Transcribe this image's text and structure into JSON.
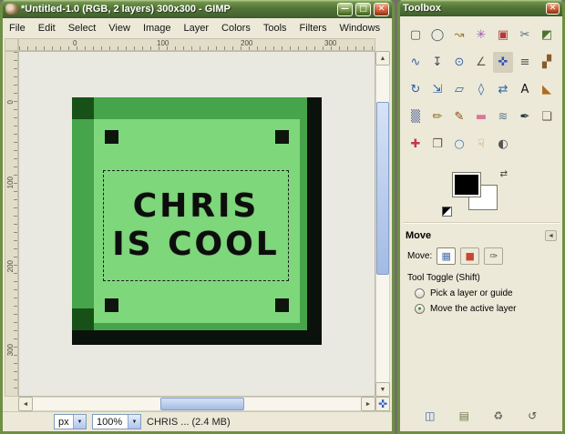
{
  "main_window": {
    "title": "*Untitled-1.0 (RGB, 2 layers) 300x300 - GIMP",
    "controls": {
      "minimize": "—",
      "maximize": "□",
      "close": "✕"
    },
    "menus": [
      "File",
      "Edit",
      "Select",
      "View",
      "Image",
      "Layer",
      "Colors",
      "Tools",
      "Filters",
      "Windows",
      "Help"
    ],
    "h_ruler_marks": [
      "0",
      "100",
      "200",
      "300"
    ],
    "v_ruler_marks": [
      "0",
      "100",
      "200",
      "300"
    ],
    "canvas": {
      "line1": "CHRIS",
      "line2": "IS COOL"
    },
    "statusbar": {
      "unit": "px",
      "zoom": "100%",
      "message": "CHRIS ... (2.4 MB)",
      "dropdown_arrow": "▼"
    },
    "scroll_arrows": {
      "left": "◄",
      "right": "►",
      "up": "▲",
      "down": "▼"
    },
    "navigation_glyph": "✜"
  },
  "image_colors": {
    "outer_green": "#46a44a",
    "inner_green": "#7fd77c",
    "corner_dark_green": "#175117",
    "shadow_black": "#0b120b"
  },
  "toolbox": {
    "title": "Toolbox",
    "close_glyph": "✕",
    "tools": [
      {
        "name": "rect-select-tool",
        "glyph": "▢",
        "color": "#4a5a6a"
      },
      {
        "name": "ellipse-select-tool",
        "glyph": "◯",
        "color": "#4a5a6a"
      },
      {
        "name": "free-select-tool",
        "glyph": "↝",
        "color": "#a07828"
      },
      {
        "name": "fuzzy-select-tool",
        "glyph": "✳",
        "color": "#9a5ab0"
      },
      {
        "name": "select-by-color-tool",
        "glyph": "▣",
        "color": "#b03a3a"
      },
      {
        "name": "scissors-select-tool",
        "glyph": "✂",
        "color": "#5a6a7a"
      },
      {
        "name": "foreground-select-tool",
        "glyph": "◩",
        "color": "#50702e"
      },
      {
        "name": "paths-tool",
        "glyph": "∿",
        "color": "#3a62a8"
      },
      {
        "name": "color-picker-tool",
        "glyph": "↧",
        "color": "#3a4a5a"
      },
      {
        "name": "zoom-tool",
        "glyph": "⊙",
        "color": "#3a62a8"
      },
      {
        "name": "measure-tool",
        "glyph": "∠",
        "color": "#6a5a3a"
      },
      {
        "name": "move-tool",
        "glyph": "✜",
        "color": "#2a52be",
        "bg": "#d4cfba"
      },
      {
        "name": "align-tool",
        "glyph": "≡",
        "color": "#555555"
      },
      {
        "name": "crop-tool",
        "glyph": "▞",
        "color": "#8a5a2a"
      },
      {
        "name": "rotate-tool",
        "glyph": "↻",
        "color": "#2a62a8"
      },
      {
        "name": "scale-tool",
        "glyph": "⇲",
        "color": "#2a62a8"
      },
      {
        "name": "shear-tool",
        "glyph": "▱",
        "color": "#2a62a8"
      },
      {
        "name": "perspective-tool",
        "glyph": "◊",
        "color": "#2a62a8"
      },
      {
        "name": "flip-tool",
        "glyph": "⇄",
        "color": "#2a62a8"
      },
      {
        "name": "text-tool",
        "glyph": "A",
        "color": "#111111"
      },
      {
        "name": "bucket-fill-tool",
        "glyph": "◣",
        "color": "#b06a20"
      },
      {
        "name": "gradient-tool",
        "glyph": "▒",
        "color": "#5a6a9a"
      },
      {
        "name": "pencil-tool",
        "glyph": "✏",
        "color": "#8a6d1f"
      },
      {
        "name": "paintbrush-tool",
        "glyph": "✎",
        "color": "#8a4513"
      },
      {
        "name": "eraser-tool",
        "glyph": "▬",
        "color": "#d87898"
      },
      {
        "name": "airbrush-tool",
        "glyph": "≋",
        "color": "#5a7a8a"
      },
      {
        "name": "ink-tool",
        "glyph": "✒",
        "color": "#223344"
      },
      {
        "name": "clone-tool",
        "glyph": "❏",
        "color": "#6a5a4a"
      },
      {
        "name": "heal-tool",
        "glyph": "✚",
        "color": "#c03a4a"
      },
      {
        "name": "perspective-clone-tool",
        "glyph": "❐",
        "color": "#6a5a4a"
      },
      {
        "name": "blur-sharpen-tool",
        "glyph": "○",
        "color": "#3a7ac0"
      },
      {
        "name": "smudge-tool",
        "glyph": "☟",
        "color": "#c08a50"
      },
      {
        "name": "dodge-burn-tool",
        "glyph": "◐",
        "color": "#555555"
      }
    ],
    "colors": {
      "foreground": "#000000",
      "background": "#ffffff",
      "swap_glyph": "⇄"
    },
    "options": {
      "title": "Move",
      "collapse_glyph": "◄",
      "move_label": "Move:",
      "move_targets": [
        {
          "name": "move-layer-button",
          "glyph": "▦",
          "color": "#4a6fb5"
        },
        {
          "name": "move-selection-button",
          "glyph": "■",
          "color": "#cc4433"
        },
        {
          "name": "move-path-button",
          "glyph": "✑",
          "color": "#555555"
        }
      ],
      "toggle_label": "Tool Toggle  (Shift)",
      "radios": [
        {
          "label": "Pick a layer or guide",
          "dot": ""
        },
        {
          "label": "Move the active layer",
          "dot": "●"
        }
      ],
      "bottom_buttons": [
        {
          "name": "save-tool-options-button",
          "glyph": "◫",
          "color": "#3a62a8"
        },
        {
          "name": "restore-tool-options-button",
          "glyph": "▤",
          "color": "#6b7a4f"
        },
        {
          "name": "delete-tool-options-button",
          "glyph": "♻",
          "color": "#666666"
        },
        {
          "name": "reset-tool-options-button",
          "glyph": "↺",
          "color": "#555555"
        }
      ]
    }
  }
}
